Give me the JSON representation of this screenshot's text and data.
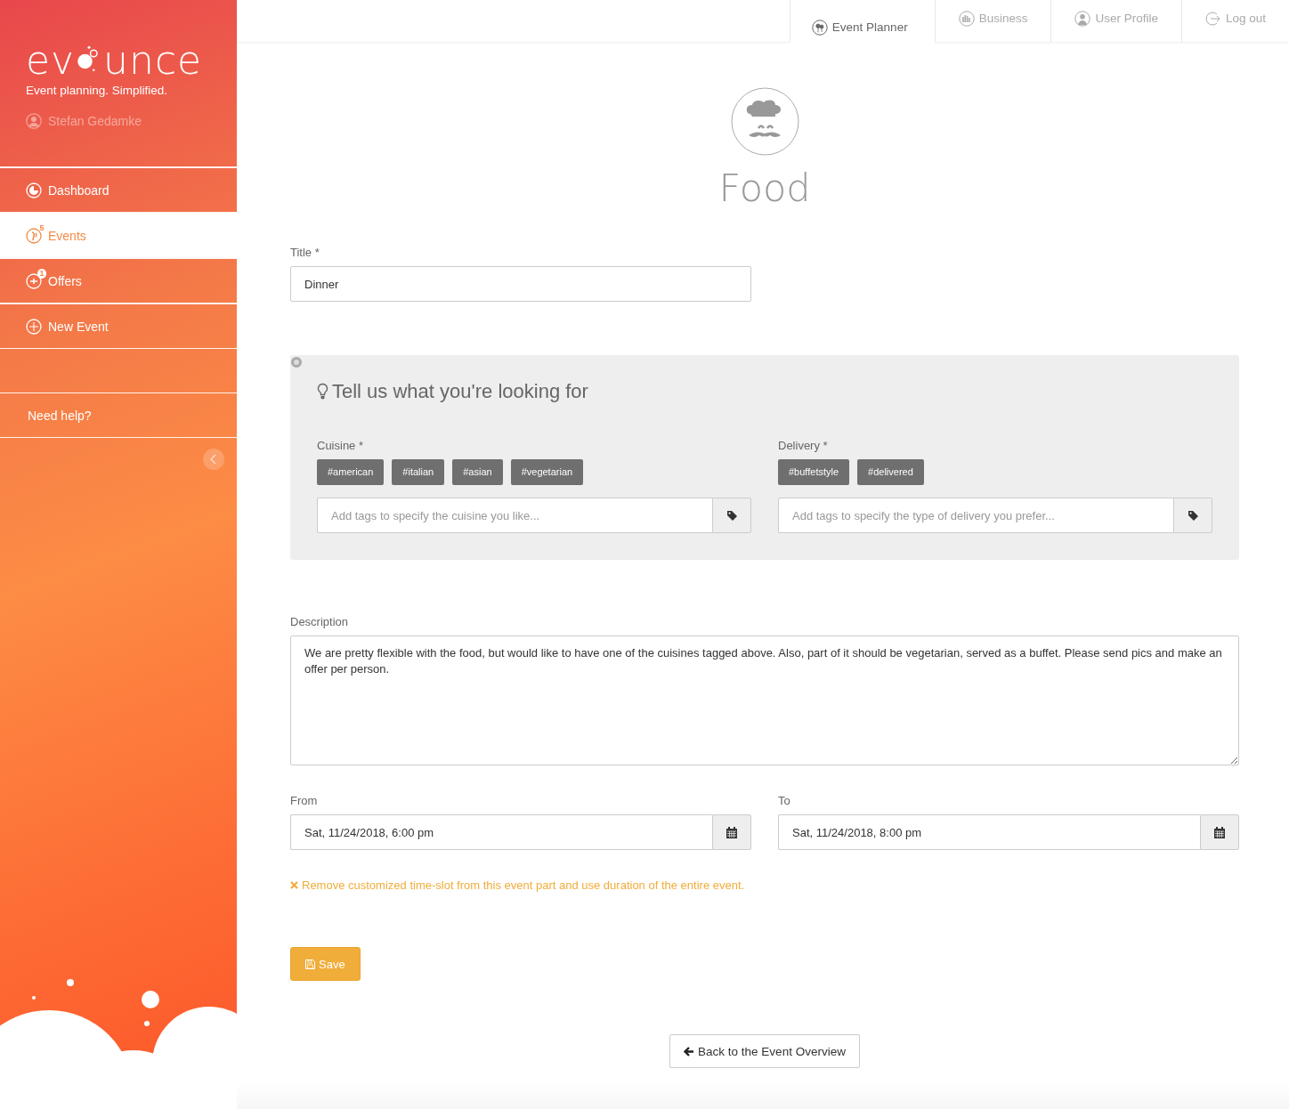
{
  "sidebar": {
    "logo": {
      "left": "ev",
      "right": "unce"
    },
    "tagline": "Event planning. Simplified.",
    "user": "Stefan Gedamke",
    "items": [
      {
        "kind": "nav",
        "label": "Dashboard",
        "selected": false
      },
      {
        "kind": "nav",
        "label": "Events",
        "badge": "5",
        "selected": true
      },
      {
        "kind": "nav",
        "label": "Offers",
        "badge": "1",
        "selected": false
      },
      {
        "kind": "nav",
        "label": "New Event",
        "selected": false
      },
      {
        "kind": "spacer"
      },
      {
        "kind": "help",
        "label": "Need help?",
        "selected": false
      }
    ]
  },
  "tabs": [
    {
      "label": "Event Planner",
      "selected": true
    },
    {
      "label": "Business",
      "selected": false
    },
    {
      "label": "User Profile",
      "selected": false
    },
    {
      "label": "Log out",
      "selected": false
    }
  ],
  "page_title": "Food",
  "title_field": {
    "label": "Title *",
    "value": "Dinner"
  },
  "panel": {
    "heading": "Tell us what you're looking for",
    "groups": [
      {
        "label": "Cuisine *",
        "tags": [
          "#american",
          "#italian",
          "#asian",
          "#vegetarian"
        ],
        "placeholder": "Add tags to specify the cuisine you like..."
      },
      {
        "label": "Delivery *",
        "tags": [
          "#buffetstyle",
          "#delivered"
        ],
        "placeholder": "Add tags to specify the type of delivery you prefer..."
      }
    ]
  },
  "description": {
    "label": "Description",
    "value": "We are pretty flexible with the food, but would like to have one of the cuisines tagged above. Also, part of it should be vegetarian, served as a buffet. Please send pics and make an offer per person."
  },
  "dates": [
    {
      "label": "From",
      "value": "Sat, 11/24/2018, 6:00 pm"
    },
    {
      "label": "To",
      "value": "Sat, 11/24/2018, 8:00 pm"
    }
  ],
  "remove_link": "Remove customized time-slot from this event part and use duration of the entire event.",
  "save_button": "Save",
  "back_button": "Back to the Event Overview"
}
